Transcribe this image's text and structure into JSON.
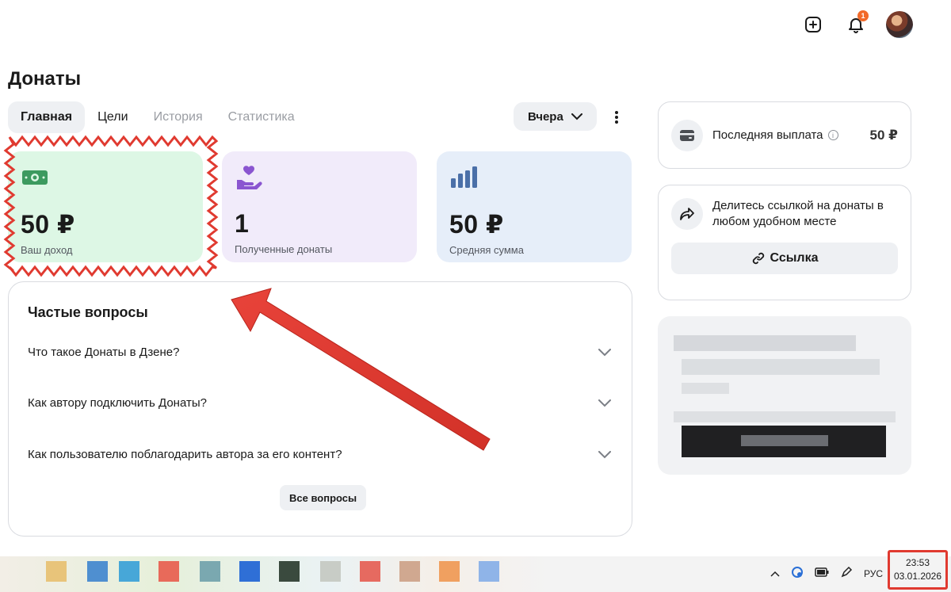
{
  "header": {
    "notification_count": "1"
  },
  "page": {
    "title": "Донаты"
  },
  "tabs": [
    {
      "label": "Главная",
      "state": "active"
    },
    {
      "label": "Цели",
      "state": "normal"
    },
    {
      "label": "История",
      "state": "muted"
    },
    {
      "label": "Статистика",
      "state": "muted"
    }
  ],
  "period": {
    "selected": "Вчера"
  },
  "stats": [
    {
      "value": "50 ₽",
      "label": "Ваш доход",
      "icon": "money-icon",
      "color": "#3c9a5f"
    },
    {
      "value": "1",
      "label": "Полученные донаты",
      "icon": "heart-hand-icon",
      "color": "#8a55d0"
    },
    {
      "value": "50 ₽",
      "label": "Средняя сумма",
      "icon": "bar-chart-icon",
      "color": "#4a6fa8"
    }
  ],
  "faq": {
    "title": "Частые вопросы",
    "items": [
      {
        "question": "Что такое Донаты в Дзене?"
      },
      {
        "question": "Как автору подключить Донаты?"
      },
      {
        "question": "Как пользователю поблагодарить автора за его контент?"
      }
    ],
    "all_button": "Все вопросы"
  },
  "payout": {
    "label": "Последняя выплата",
    "value": "50 ₽"
  },
  "share": {
    "text": "Делитесь ссылкой на донаты в любом удобном месте",
    "button": "Ссылка"
  },
  "taskbar": {
    "language": "РУС",
    "time": "23:53",
    "date": "03.01.2026"
  },
  "colors": {
    "annotation_red": "#e03a30",
    "accent_green_bg": "#ddf7e5",
    "accent_purple_bg": "#f1ebfa",
    "accent_blue_bg": "#e6eef9"
  }
}
